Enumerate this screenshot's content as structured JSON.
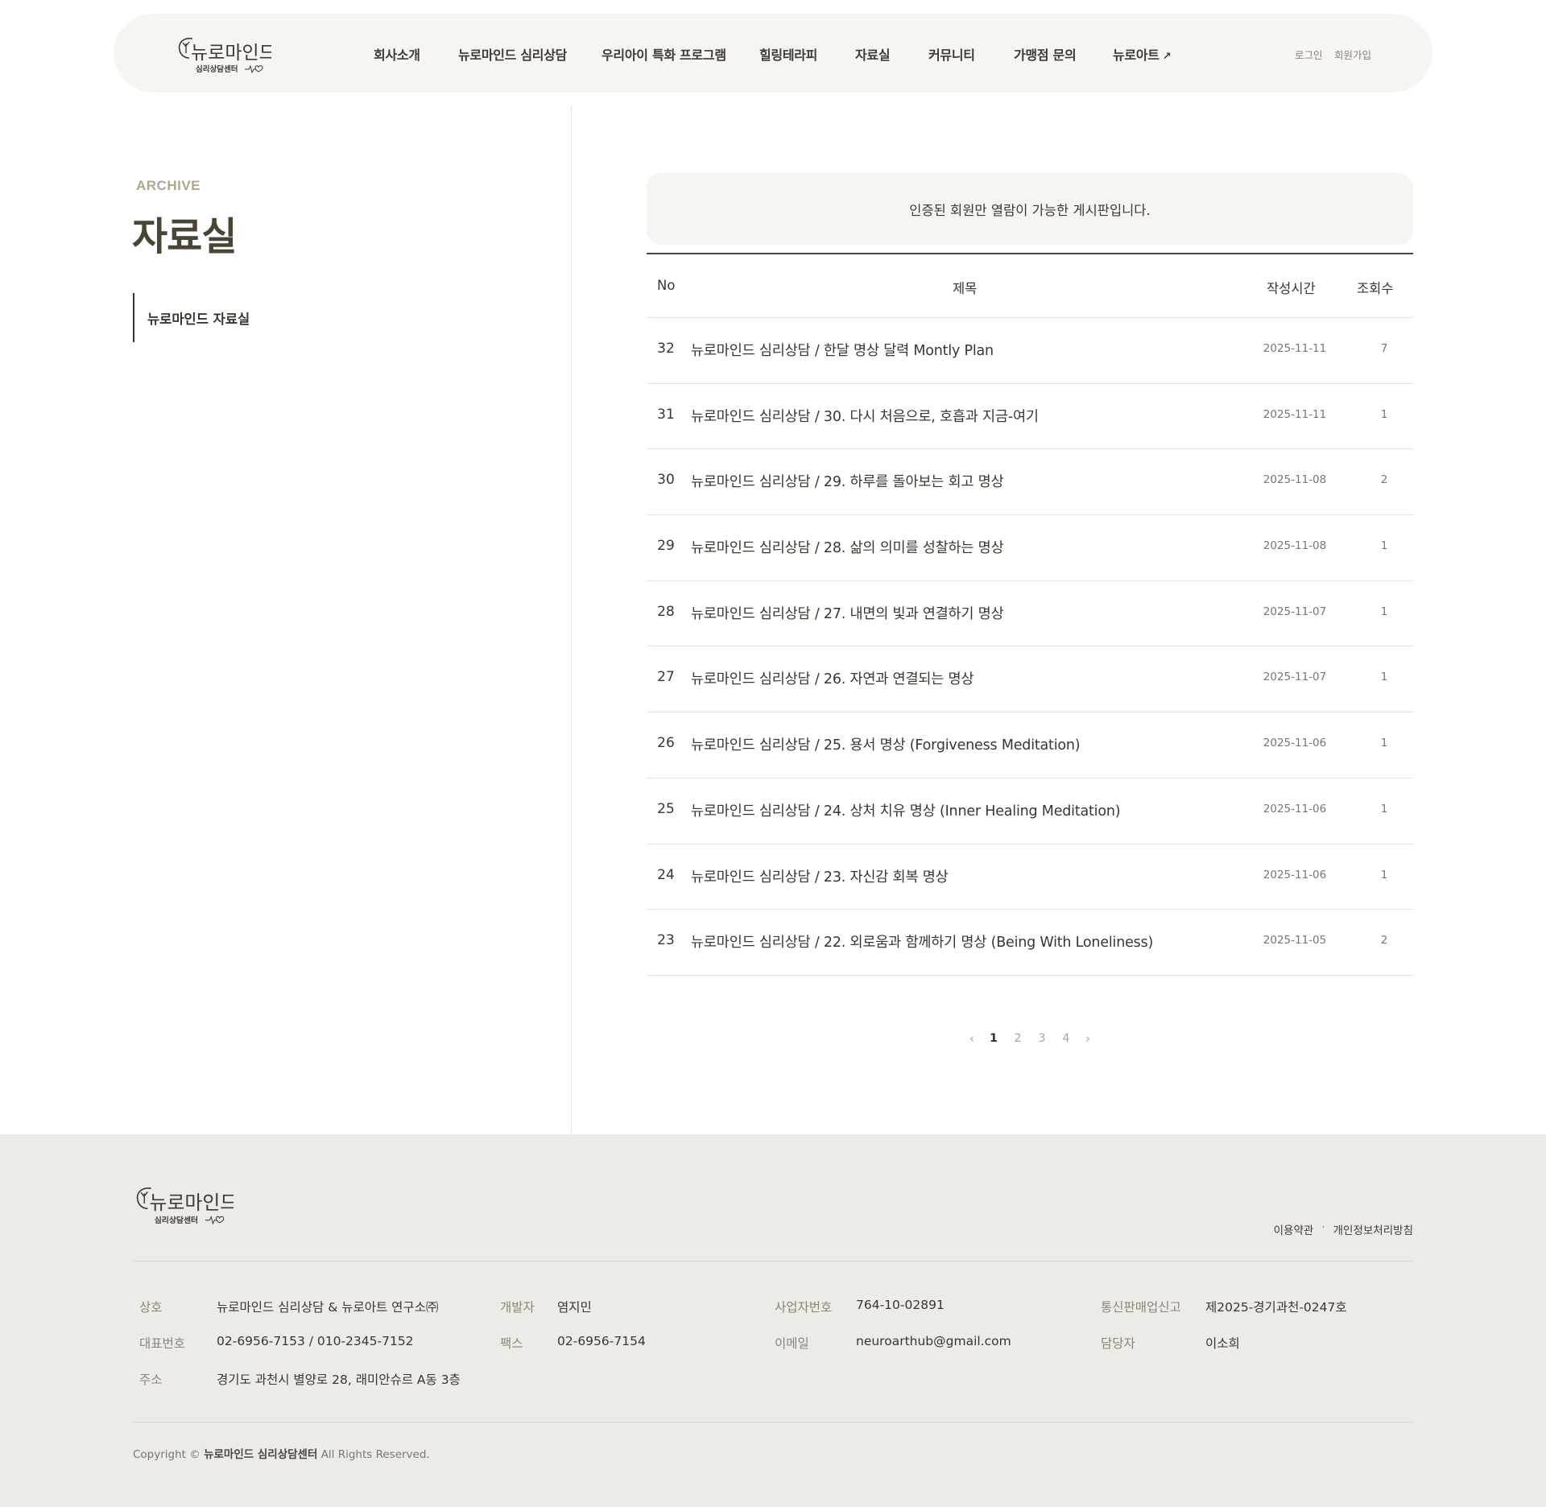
{
  "header": {
    "logo_name": "뉴로마인드",
    "logo_sub": "심리상담센터",
    "nav": [
      {
        "label": "회사소개"
      },
      {
        "label": "뉴로마인드 심리상담"
      },
      {
        "label": "우리아이 특화 프로그램"
      },
      {
        "label": "힐링테라피"
      },
      {
        "label": "자료실"
      },
      {
        "label": "커뮤니티"
      },
      {
        "label": "가맹점 문의"
      },
      {
        "label": "뉴로아트",
        "ext": "↗"
      }
    ],
    "login": "로그인",
    "signup": "회원가입"
  },
  "sidebar": {
    "subtitle": "ARCHIVE",
    "title": "자료실",
    "menu": [
      "뉴로마인드 자료실"
    ]
  },
  "notice": "인증된 회원만 열람이 가능한 게시판입니다.",
  "table": {
    "headers": {
      "no": "No",
      "title": "제목",
      "date": "작성시간",
      "views": "조회수"
    },
    "rows": [
      {
        "no": "32",
        "title": "뉴로마인드 심리상담 / 한달 명상 달력 Montly Plan",
        "date": "2025-11-11",
        "views": "7"
      },
      {
        "no": "31",
        "title": "뉴로마인드 심리상담 / 30. 다시 처음으로, 호흡과 지금-여기",
        "date": "2025-11-11",
        "views": "1"
      },
      {
        "no": "30",
        "title": "뉴로마인드 심리상담 / 29. 하루를 돌아보는 회고 명상",
        "date": "2025-11-08",
        "views": "2"
      },
      {
        "no": "29",
        "title": "뉴로마인드 심리상담 / 28. 삶의 의미를 성찰하는 명상",
        "date": "2025-11-08",
        "views": "1"
      },
      {
        "no": "28",
        "title": "뉴로마인드 심리상담 / 27. 내면의 빛과 연결하기 명상",
        "date": "2025-11-07",
        "views": "1"
      },
      {
        "no": "27",
        "title": "뉴로마인드 심리상담 / 26. 자연과 연결되는 명상",
        "date": "2025-11-07",
        "views": "1"
      },
      {
        "no": "26",
        "title": "뉴로마인드 심리상담 / 25. 용서 명상 (Forgiveness Meditation)",
        "date": "2025-11-06",
        "views": "1"
      },
      {
        "no": "25",
        "title": "뉴로마인드 심리상담 / 24. 상처 치유 명상 (Inner Healing Meditation)",
        "date": "2025-11-06",
        "views": "1"
      },
      {
        "no": "24",
        "title": "뉴로마인드 심리상담 / 23. 자신감 회복 명상",
        "date": "2025-11-06",
        "views": "1"
      },
      {
        "no": "23",
        "title": "뉴로마인드 심리상담 / 22. 외로움과 함께하기 명상 (Being With Loneliness)",
        "date": "2025-11-05",
        "views": "2"
      }
    ]
  },
  "pagination": {
    "prev": "‹",
    "next": "›",
    "pages": [
      "1",
      "2",
      "3",
      "4"
    ],
    "current": "1"
  },
  "footer": {
    "links": [
      "이용약관",
      "·",
      "개인정보처리방침"
    ],
    "info": [
      {
        "k": "상호",
        "v": "뉴로마인드 심리상담 & 뉴로아트 연구소㈜"
      },
      {
        "k": "개발자",
        "v": "염지민"
      },
      {
        "k": "사업자번호",
        "v": "764-10-02891"
      },
      {
        "k": "통신판매업신고",
        "v": "제2025-경기과천-0247호"
      },
      {
        "k": "대표번호",
        "v": "02-6956-7153 / 010-2345-7152"
      },
      {
        "k": "팩스",
        "v": "02-6956-7154"
      },
      {
        "k": "이메일",
        "v": "neuroarthub@gmail.com"
      },
      {
        "k": "담당자",
        "v": "이소희"
      },
      {
        "k": "주소",
        "v": "경기도 과천시 별양로 28, 래미안슈르 A동 3층"
      }
    ],
    "copyright_prefix": "Copyright ©",
    "copyright_name": "뉴로마인드 심리상담센터",
    "copyright_suffix": "All Rights Reserved."
  },
  "colors": {
    "accent": "#b2a58e",
    "header_bg": "#f6f5f2",
    "footer_bg": "#edebe6",
    "text": "#3a362f"
  }
}
